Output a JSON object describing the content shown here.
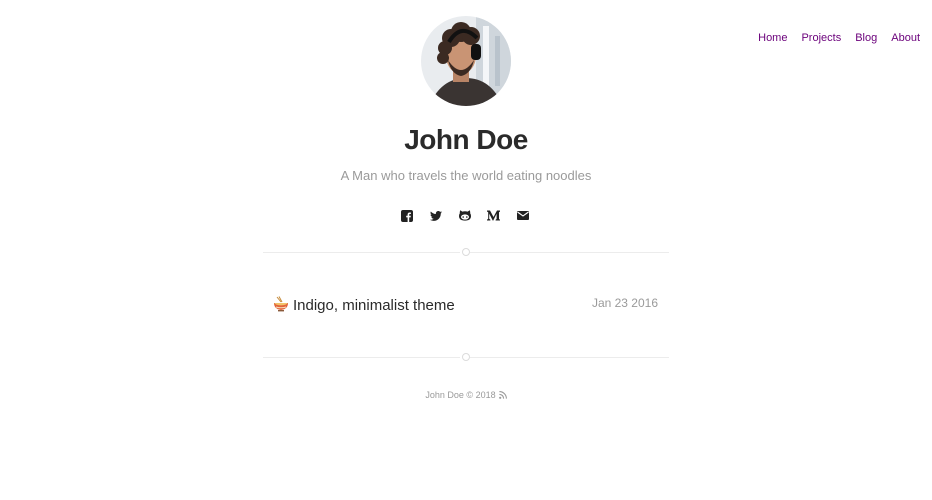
{
  "nav": {
    "items": [
      {
        "label": "Home"
      },
      {
        "label": "Projects"
      },
      {
        "label": "Blog"
      },
      {
        "label": "About"
      }
    ],
    "color": "#6b007b"
  },
  "profile": {
    "name": "John Doe",
    "tagline": "A Man who travels the world eating noodles"
  },
  "social": {
    "icons": [
      "facebook-icon",
      "twitter-icon",
      "github-icon",
      "medium-icon",
      "email-icon"
    ]
  },
  "posts": [
    {
      "emoji": "noodle-bowl-icon",
      "title": "Indigo, minimalist theme",
      "date": "Jan 23 2016"
    }
  ],
  "footer": {
    "text": "John Doe © 2018",
    "icon": "rss-icon"
  }
}
